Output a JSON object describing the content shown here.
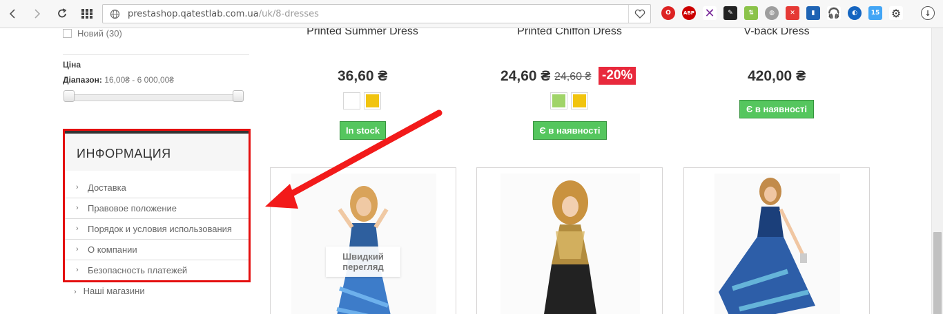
{
  "browser": {
    "url_host": "prestashop.qatestlab.com.ua",
    "url_path": "/uk/8-dresses"
  },
  "filters": {
    "new_label": "Новий (30)",
    "price_title": "Ціна",
    "range_label": "Діапазон:",
    "range_value": "16,00₴ - 6 000,00₴"
  },
  "info_block": {
    "title": "ИНФОРМАЦИЯ",
    "items": [
      {
        "label": "Доставка"
      },
      {
        "label": "Правовое положение"
      },
      {
        "label": "Порядок и условия использования"
      },
      {
        "label": "О компании"
      },
      {
        "label": "Безопасность платежей"
      }
    ],
    "extra_item": "Наші магазини"
  },
  "products": [
    {
      "name": "Printed Summer Dress",
      "price": "36,60 ₴",
      "stock": "In stock",
      "colors": [
        "#ffffff",
        "#f1c40f"
      ]
    },
    {
      "name": "Printed Chiffon Dress",
      "price": "24,60 ₴",
      "old_price": "24,60 ₴",
      "discount": "-20%",
      "stock": "Є в наявності",
      "colors": [
        "#a0d468",
        "#f1c40f"
      ]
    },
    {
      "name": "V-back Dress",
      "price": "420,00 ₴",
      "stock": "Є в наявності"
    }
  ],
  "cards": {
    "quick_view": "Швидкий перегляд"
  },
  "colors": {
    "accent_red": "#e40e0e",
    "stock_green": "#55c65e",
    "discount_red": "#e8293c"
  }
}
